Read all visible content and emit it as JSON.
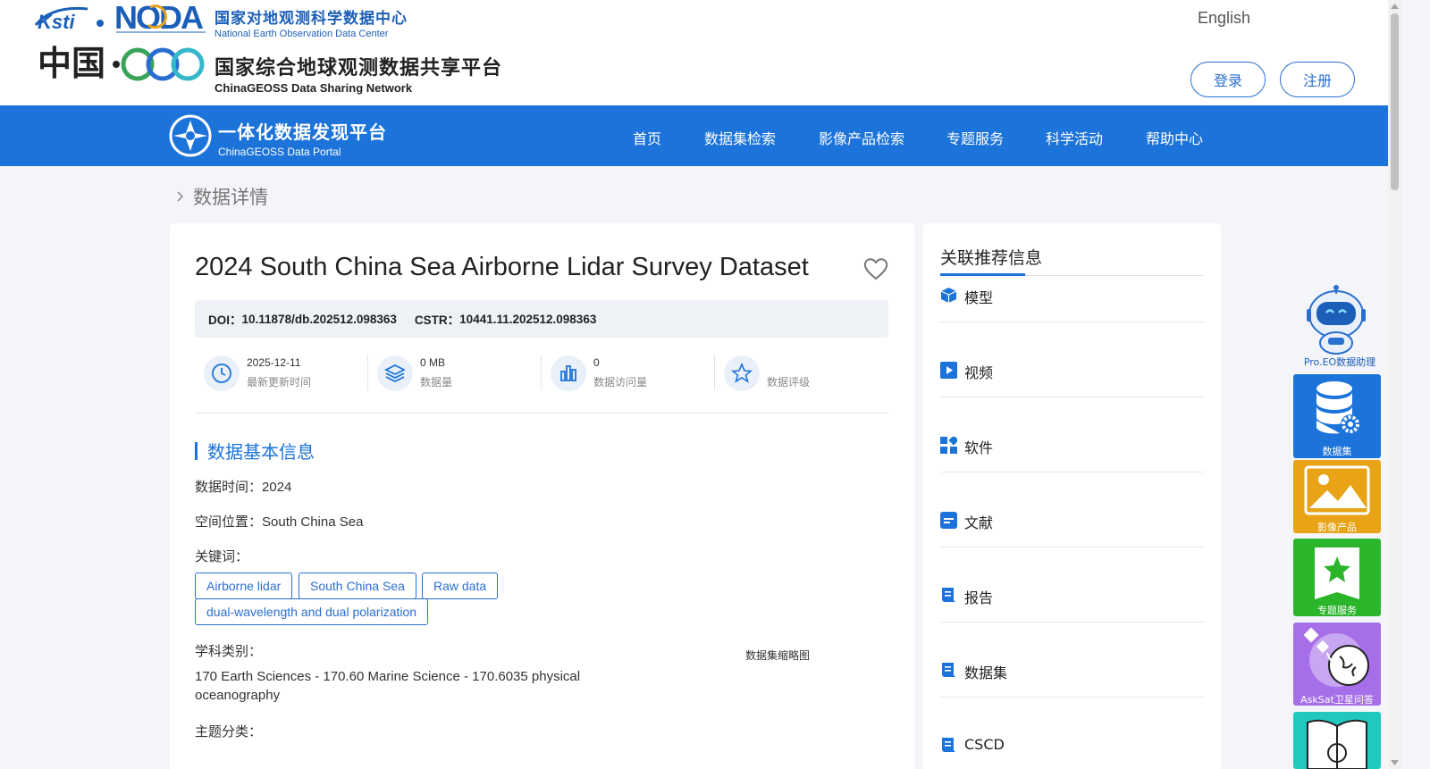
{
  "header": {
    "noda_cn": "国家对地观测科学数据中心",
    "noda_en": "National Earth Observation Data Center",
    "geo_cn": "国家综合地球观测数据共享平台",
    "geo_en": "ChinaGEOSS Data Sharing Network",
    "lang": "English",
    "login": "登录",
    "register": "注册"
  },
  "nav": {
    "portal_cn": "一体化数据发现平台",
    "portal_en": "ChinaGEOSS Data Portal",
    "items": [
      "首页",
      "数据集检索",
      "影像产品检索",
      "专题服务",
      "科学活动",
      "帮助中心"
    ]
  },
  "breadcrumb": "数据详情",
  "dataset": {
    "title": "2024 South China Sea Airborne Lidar Survey Dataset",
    "doi_label": "DOI：",
    "doi": "10.11878/db.202512.098363",
    "cstr_label": "CSTR：",
    "cstr": "10441.11.202512.098363",
    "stats": [
      {
        "value": "2025-12-11",
        "label": "最新更新时间",
        "icon": "clock-icon"
      },
      {
        "value": "0 MB",
        "label": "数据量",
        "icon": "layers-icon"
      },
      {
        "value": "0",
        "label": "数据访问量",
        "icon": "bar-chart-icon"
      },
      {
        "value": "",
        "label": "数据评级",
        "icon": "star-icon"
      }
    ],
    "section_title": "数据基本信息",
    "time_label": "数据时间：",
    "time_value": "2024",
    "location_label": "空间位置：",
    "location_value": "South China Sea",
    "keywords_label": "关键词：",
    "keywords": [
      "Airborne lidar",
      "South China Sea",
      "Raw data",
      "dual-wavelength and dual polarization"
    ],
    "subject_label": "学科类别：",
    "subject_value": "170 Earth Sciences - 170.60 Marine Science - 170.6035 physical oceanography",
    "topic_label": "主题分类：",
    "thumbnail_label": "数据集缩略图"
  },
  "sidebar": {
    "title": "关联推荐信息",
    "items": [
      {
        "label": "模型",
        "icon": "cube-icon"
      },
      {
        "label": "视频",
        "icon": "video-play-icon"
      },
      {
        "label": "软件",
        "icon": "apps-icon"
      },
      {
        "label": "文献",
        "icon": "document-icon"
      },
      {
        "label": "报告",
        "icon": "report-icon"
      },
      {
        "label": "数据集",
        "icon": "report-icon"
      },
      {
        "label": "CSCD",
        "icon": "report-icon"
      }
    ]
  },
  "float_tools": [
    {
      "label": "Pro.EO数据助理",
      "icon": "robot-icon"
    },
    {
      "label": "数据集",
      "icon": "database-gear-icon",
      "color": "#1c73d9"
    },
    {
      "label": "影像产品",
      "icon": "image-icon",
      "color": "#e8a317"
    },
    {
      "label": "专题服务",
      "icon": "star-badge-icon",
      "color": "#2bb52b"
    },
    {
      "label": "AskSat卫星问答",
      "icon": "satellite-globe-icon",
      "color": "#a66ee8"
    },
    {
      "label": "",
      "icon": "book-icon",
      "color": "#22c8c0"
    }
  ],
  "colors": {
    "primary": "#1c73d9",
    "page_bg": "#f3f5f8"
  }
}
